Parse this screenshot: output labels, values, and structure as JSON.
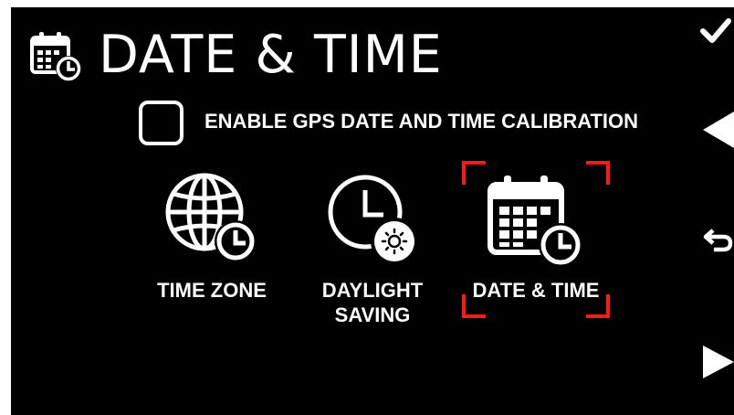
{
  "header": {
    "title": "DATE & TIME",
    "icon": "calendar-clock-icon"
  },
  "gps_option": {
    "label": "ENABLE GPS DATE AND TIME CALIBRATION",
    "checked": false
  },
  "tiles": [
    {
      "line1": "TIME ZONE",
      "line2": "",
      "icon": "globe-clock-icon",
      "selected": false
    },
    {
      "line1": "DAYLIGHT",
      "line2": "SAVING",
      "icon": "clock-sun-icon",
      "selected": false
    },
    {
      "line1": "DATE & TIME",
      "line2": "",
      "icon": "calendar-clock-icon",
      "selected": true
    }
  ],
  "side_buttons": [
    {
      "icon": "check-icon"
    },
    {
      "icon": "arrow-left-icon"
    },
    {
      "icon": "return-icon"
    },
    {
      "icon": "arrow-right-icon"
    }
  ],
  "colors": {
    "background": "#000000",
    "foreground": "#ffffff",
    "selection": "#ff1a1a"
  }
}
